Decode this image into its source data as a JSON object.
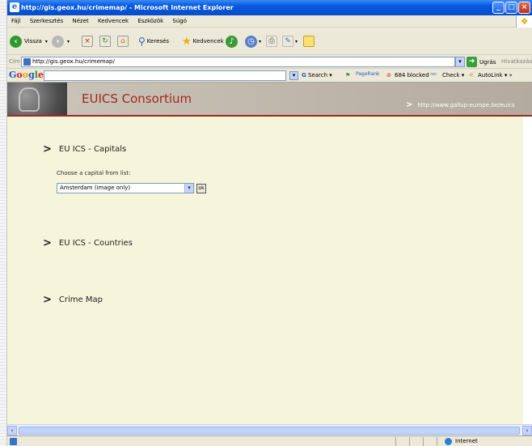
{
  "window": {
    "title": "http://gis.geox.hu/crimemap/ - Microsoft Internet Explorer"
  },
  "menu": [
    "Fájl",
    "Szerkesztés",
    "Nézet",
    "Kedvencek",
    "Eszközök",
    "Súgó"
  ],
  "toolbar": {
    "back": "Vissza",
    "search": "Keresés",
    "favorites": "Kedvencek"
  },
  "address": {
    "label": "Cím",
    "url": "http://gis.geox.hu/crimemap/",
    "go": "Ugrás",
    "links": "Hivatkozások"
  },
  "google": {
    "logo": "Google",
    "search": "Search",
    "pagerank": "PageRank",
    "blocked": "684 blocked",
    "check": "Check",
    "autolink": "AutoLink"
  },
  "banner": {
    "title": "EUICS Consortium",
    "url": "http://www.gallup-europe.be/euics"
  },
  "sections": {
    "capitals": "EU ICS - Capitals",
    "choose_label": "Choose a capital from list:",
    "capital_selected": "Amsterdam (image only)",
    "ok": "ok",
    "countries": "EU ICS - Countries",
    "crimemap": "Crime Map"
  },
  "status": {
    "zone": "Internet"
  }
}
